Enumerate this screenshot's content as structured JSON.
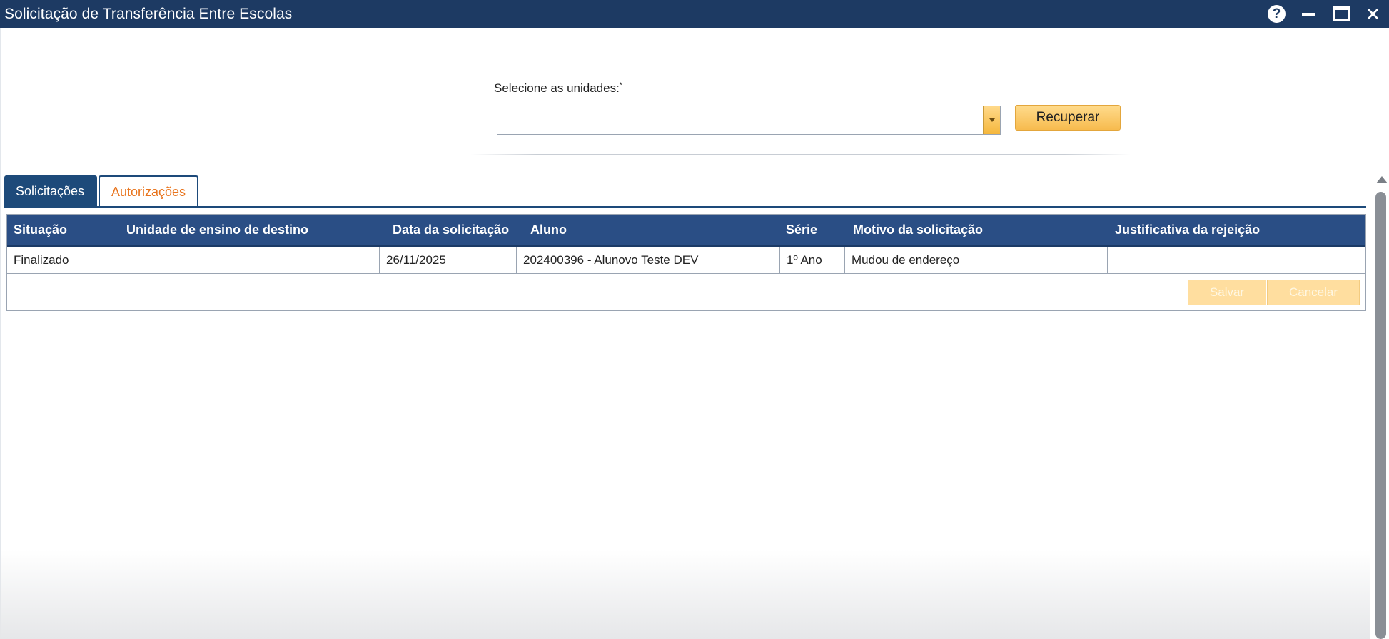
{
  "window": {
    "title": "Solicitação de Transferência Entre Escolas",
    "help_glyph": "?",
    "close_glyph": "✕"
  },
  "filter": {
    "label": "Selecione as unidades:",
    "required_mark": "*",
    "selected_value": "",
    "recuperar_label": "Recuperar"
  },
  "tabs": [
    {
      "label": "Solicitações",
      "active": false
    },
    {
      "label": "Autorizações",
      "active": true
    }
  ],
  "grid": {
    "columns": [
      "Situação",
      "Unidade de ensino de destino",
      "Data da solicitação",
      "Aluno",
      "Série",
      "Motivo da solicitação",
      "Justificativa da rejeição"
    ],
    "rows": [
      [
        "Finalizado",
        "",
        "26/11/2025",
        "202400396 - Alunovo Teste DEV",
        "1º Ano",
        "Mudou de endereço",
        ""
      ]
    ],
    "footer_buttons": {
      "salvar_label": "Salvar",
      "cancelar_label": "Cancelar"
    }
  },
  "colors": {
    "titlebar": "#1d3a63",
    "header": "#2a4e85",
    "accent_orange": "#e8741d",
    "button_yellow": "#f7bb4e"
  }
}
